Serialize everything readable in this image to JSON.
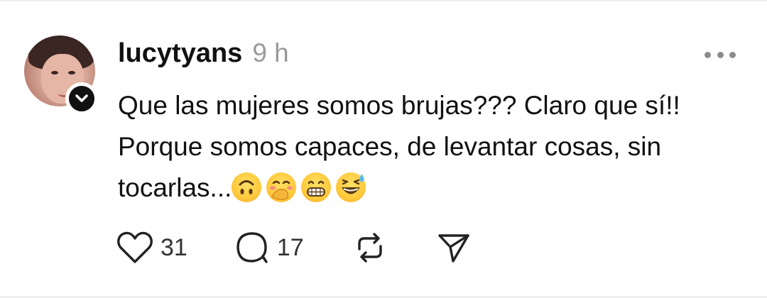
{
  "post": {
    "username": "lucytyans",
    "timestamp": "9 h",
    "text_line1": "Que las mujeres somos brujas??? Claro que sí!!",
    "text_line2": "Porque somos capaces, de levantar cosas, sin",
    "text_line3": "tocarlas...",
    "emojis": [
      "upside-down-face-emoji",
      "hand-over-mouth-emoji",
      "grinning-face-emoji",
      "grinning-sweat-emoji"
    ]
  },
  "actions": {
    "likes": "31",
    "replies": "17"
  },
  "colors": {
    "text": "#111111",
    "muted": "#9a9a9a",
    "icon": "#222222"
  }
}
